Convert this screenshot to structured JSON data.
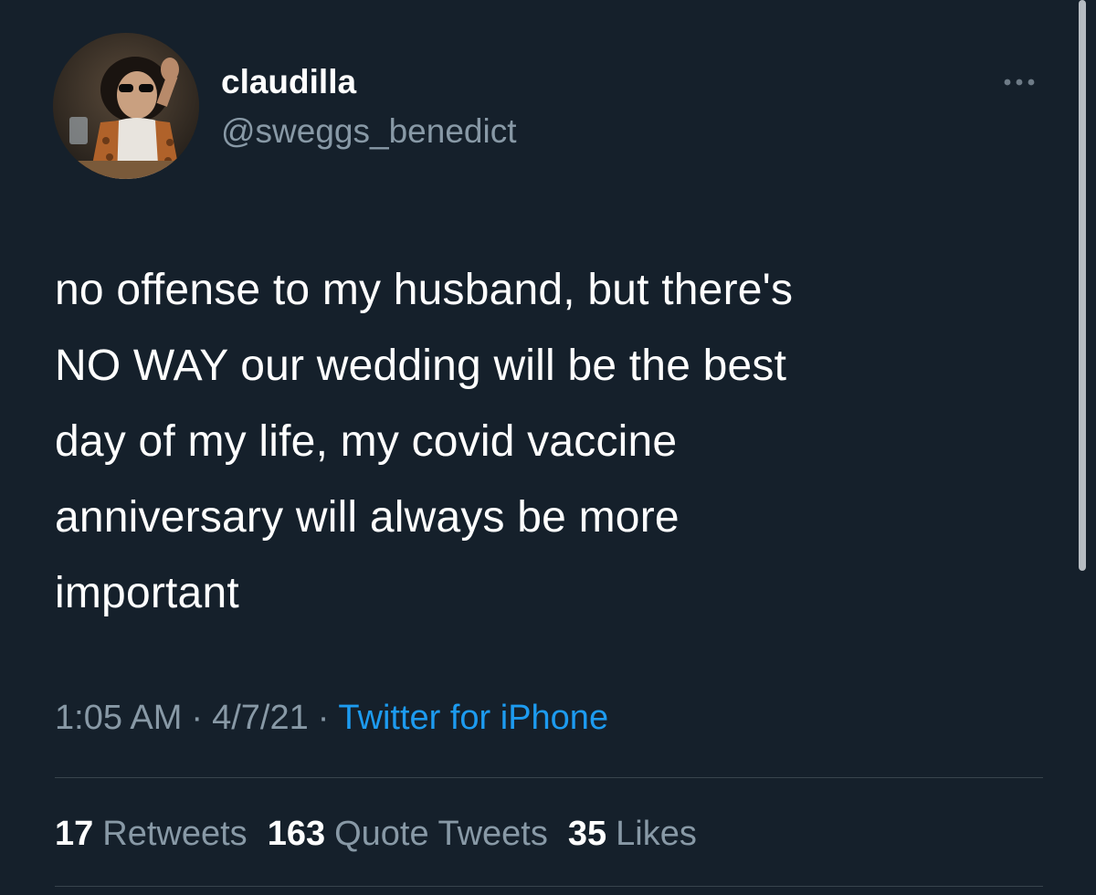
{
  "user": {
    "display_name": "claudilla",
    "handle": "@sweggs_benedict"
  },
  "tweet": {
    "text": "no offense to my husband, but there's\nNO WAY our wedding will be the best\nday of my life, my covid vaccine\nanniversary will always be more\nimportant",
    "time": "1:05 AM",
    "date": "4/7/21",
    "separator": "·",
    "source": "Twitter for iPhone"
  },
  "stats": {
    "retweets": {
      "count": "17",
      "label": "Retweets"
    },
    "quote_tweets": {
      "count": "163",
      "label": "Quote Tweets"
    },
    "likes": {
      "count": "35",
      "label": "Likes"
    }
  },
  "icons": {
    "more": "more-horizontal-icon",
    "avatar": "user-avatar"
  },
  "colors": {
    "background": "#15202b",
    "primary_text": "#ffffff",
    "secondary_text": "#8899a6",
    "link": "#1d9bf0",
    "divider": "#38444d"
  }
}
